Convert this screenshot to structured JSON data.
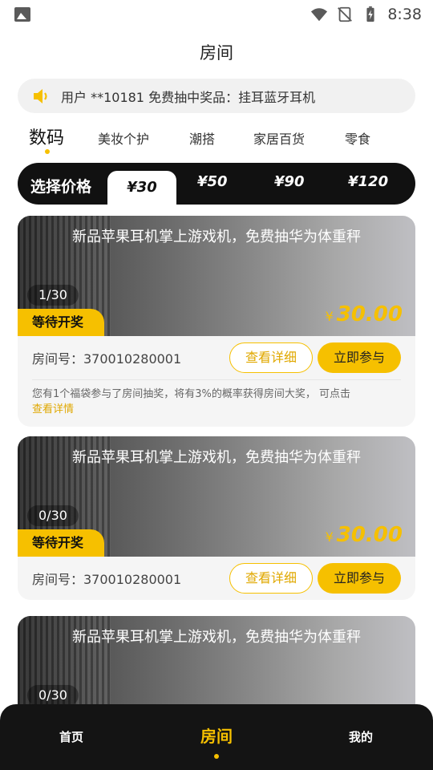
{
  "status_bar": {
    "time": "8:38",
    "icons": [
      "gallery-icon",
      "wifi-icon",
      "no-signal-icon",
      "battery-charging-icon"
    ]
  },
  "header": {
    "title": "房间"
  },
  "notice": {
    "icon": "speaker-icon",
    "text": "用户 **10181 免费抽中奖品：挂耳蓝牙耳机"
  },
  "categories": [
    {
      "label": "数码",
      "active": true
    },
    {
      "label": "美妆个护"
    },
    {
      "label": "潮搭"
    },
    {
      "label": "家居百货"
    },
    {
      "label": "零食"
    }
  ],
  "price_filter": {
    "label": "选择价格",
    "options": [
      "¥30",
      "¥50",
      "¥90",
      "¥120"
    ],
    "selected": "¥30"
  },
  "rooms": [
    {
      "title": "新品苹果耳机掌上游戏机，免费抽华为体重秤",
      "count": "1/30",
      "status": "等待开奖",
      "currency": "¥",
      "price": "30.00",
      "room_label": "房间号：370010280001",
      "detail_label": "查看详细",
      "join_label": "立即参与",
      "note": "您有1个福袋参与了房间抽奖，将有3%的概率获得房间大奖， 可点击",
      "note_link": "查看详情"
    },
    {
      "title": "新品苹果耳机掌上游戏机，免费抽华为体重秤",
      "count": "0/30",
      "status": "等待开奖",
      "currency": "¥",
      "price": "30.00",
      "room_label": "房间号：370010280001",
      "detail_label": "查看详细",
      "join_label": "立即参与"
    },
    {
      "title": "新品苹果耳机掌上游戏机，免费抽华为体重秤",
      "count": "0/30"
    }
  ],
  "bottom_nav": [
    {
      "label": "首页"
    },
    {
      "label": "房间",
      "active": true
    },
    {
      "label": "我的"
    }
  ],
  "colors": {
    "accent": "#f6c000",
    "dark": "#111111",
    "card_bg": "#f5f5f5"
  }
}
